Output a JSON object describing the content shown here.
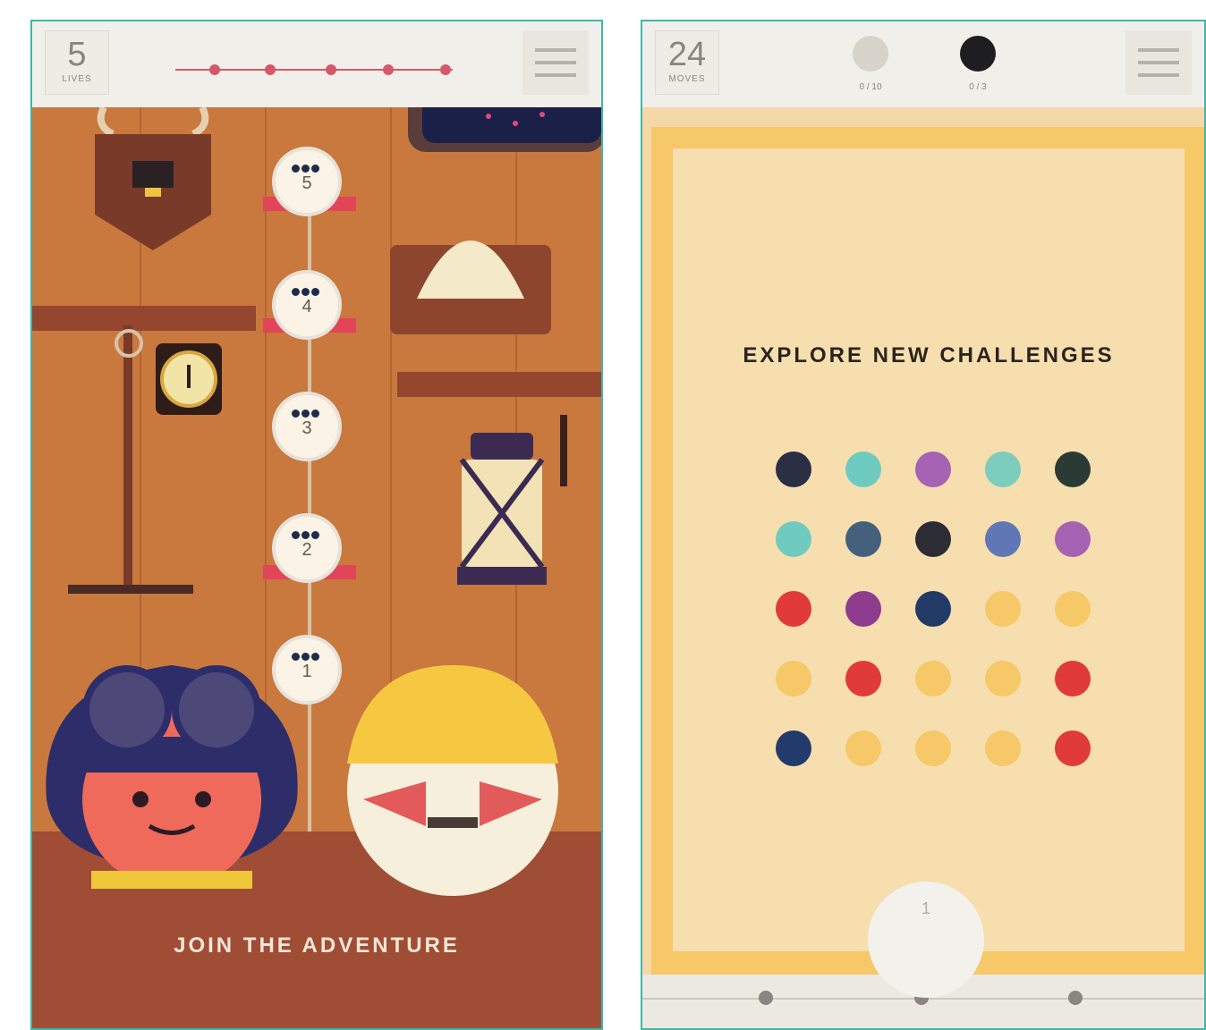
{
  "left_screen": {
    "counter": {
      "value": "5",
      "label": "LIVES"
    },
    "track_title": "",
    "levels": [
      "5",
      "4",
      "3",
      "2",
      "1"
    ],
    "banner": "JOIN THE ADVENTURE",
    "icons": [
      "menu-icon",
      "antler-trophy",
      "seashell",
      "lantern",
      "pickaxe",
      "clock",
      "aviator-girl-avatar",
      "old-sailor-avatar"
    ]
  },
  "right_screen": {
    "counter": {
      "value": "24",
      "label": "MOVES"
    },
    "modes": [
      {
        "icon": "anchor-icon",
        "label": "0 / 10"
      },
      {
        "icon": "anchor-icon",
        "label": "0 / 3"
      }
    ],
    "headline": "EXPLORE NEW CHALLENGES",
    "bottom_level": "1",
    "board_colors": [
      [
        "#2a2f44",
        "#6fcbbf",
        "#a662b3",
        "#7ccdbd",
        "#2a3a34"
      ],
      [
        "#6fcbbf",
        "#44607c",
        "#2c2c34",
        "#5f77b4",
        "#a662b3"
      ],
      [
        "#e03a3a",
        "#8e3c8e",
        "#223a66",
        "#f6c868",
        "#f6c868"
      ],
      [
        "#f6c868",
        "#e03a3a",
        "#f6c868",
        "#f6c868",
        "#e03a3a"
      ],
      [
        "#233b6a",
        "#f6c868",
        "#f6c868",
        "#f6c868",
        "#e03a3a"
      ]
    ]
  },
  "colors": {
    "teal_border": "#3cb8a8",
    "wall": "#c9793e",
    "board": "#f6c868"
  }
}
